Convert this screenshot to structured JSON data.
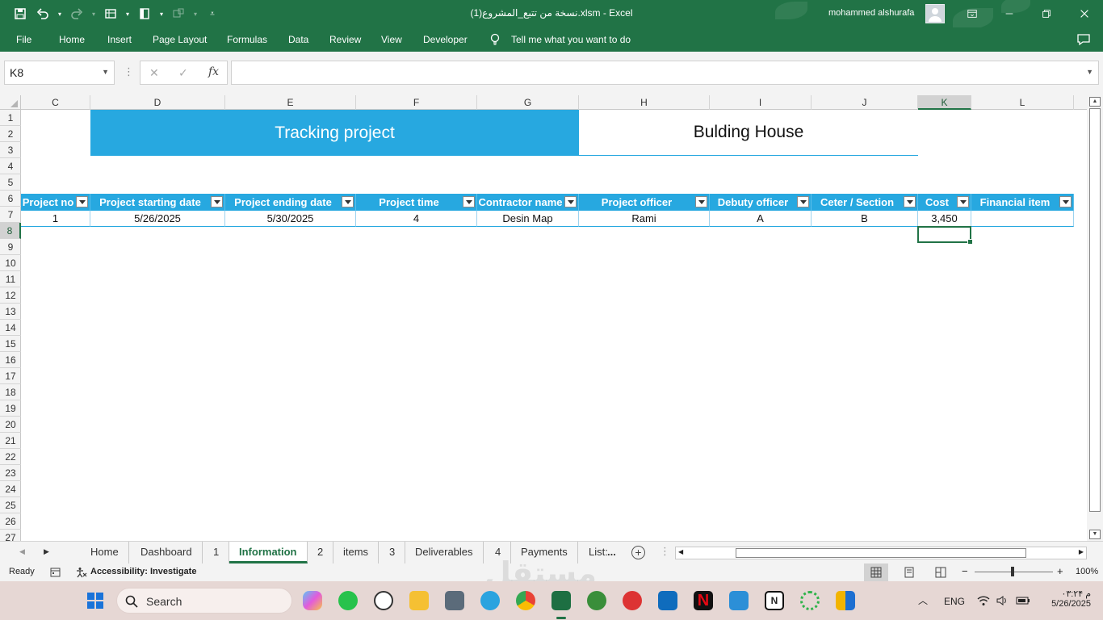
{
  "titlebar": {
    "doc_title": "نسخة من تتبع_المشروع(1).xlsm  -  Excel",
    "user_name": "mohammed alshurafa",
    "qat_icons": [
      "save-icon",
      "undo-icon",
      "redo-icon",
      "form-icon",
      "table-icon",
      "chart-icon",
      "customize-icon"
    ]
  },
  "ribbon": {
    "tabs": [
      "File",
      "Home",
      "Insert",
      "Page Layout",
      "Formulas",
      "Data",
      "Review",
      "View",
      "Developer"
    ],
    "tell_me": "Tell me what you want to do"
  },
  "formula_bar": {
    "name_box": "K8",
    "fx": "fx",
    "formula": ""
  },
  "columns": [
    "C",
    "D",
    "E",
    "F",
    "G",
    "H",
    "I",
    "J",
    "K",
    "L"
  ],
  "rows": [
    "1",
    "2",
    "3",
    "4",
    "5",
    "6",
    "7",
    "8",
    "9",
    "10",
    "11",
    "12",
    "13",
    "14",
    "15",
    "16",
    "17",
    "18",
    "19",
    "20",
    "21",
    "22",
    "23",
    "24",
    "25",
    "26",
    "27"
  ],
  "sheet": {
    "title_band": "Tracking project",
    "subtitle_band": "Bulding House",
    "table_headers": [
      "Project no",
      "Project starting date",
      "Project ending date",
      "Project time",
      "Contractor name",
      "Project officer",
      "Debuty officer",
      "Ceter / Section",
      "Cost",
      "Financial item"
    ],
    "table_row": [
      "1",
      "5/26/2025",
      "5/30/2025",
      "4",
      "Desin Map",
      "Rami",
      "A",
      "B",
      "3,450",
      ""
    ]
  },
  "sheet_tabs": [
    "Home",
    "Dashboard",
    "1",
    "Information",
    "2",
    "items",
    "3",
    "Deliverables",
    "4",
    "Payments",
    "List:",
    "..."
  ],
  "active_sheet": "Information",
  "status": {
    "ready": "Ready",
    "accessibility": "Accessibility: Investigate",
    "zoom": "100%"
  },
  "taskbar": {
    "search_placeholder": "Search",
    "lang": "ENG",
    "time": "۰۳:۲۴ م",
    "date": "5/26/2025"
  },
  "colors": {
    "excel_green": "#217346",
    "table_blue": "#27a8e0"
  }
}
